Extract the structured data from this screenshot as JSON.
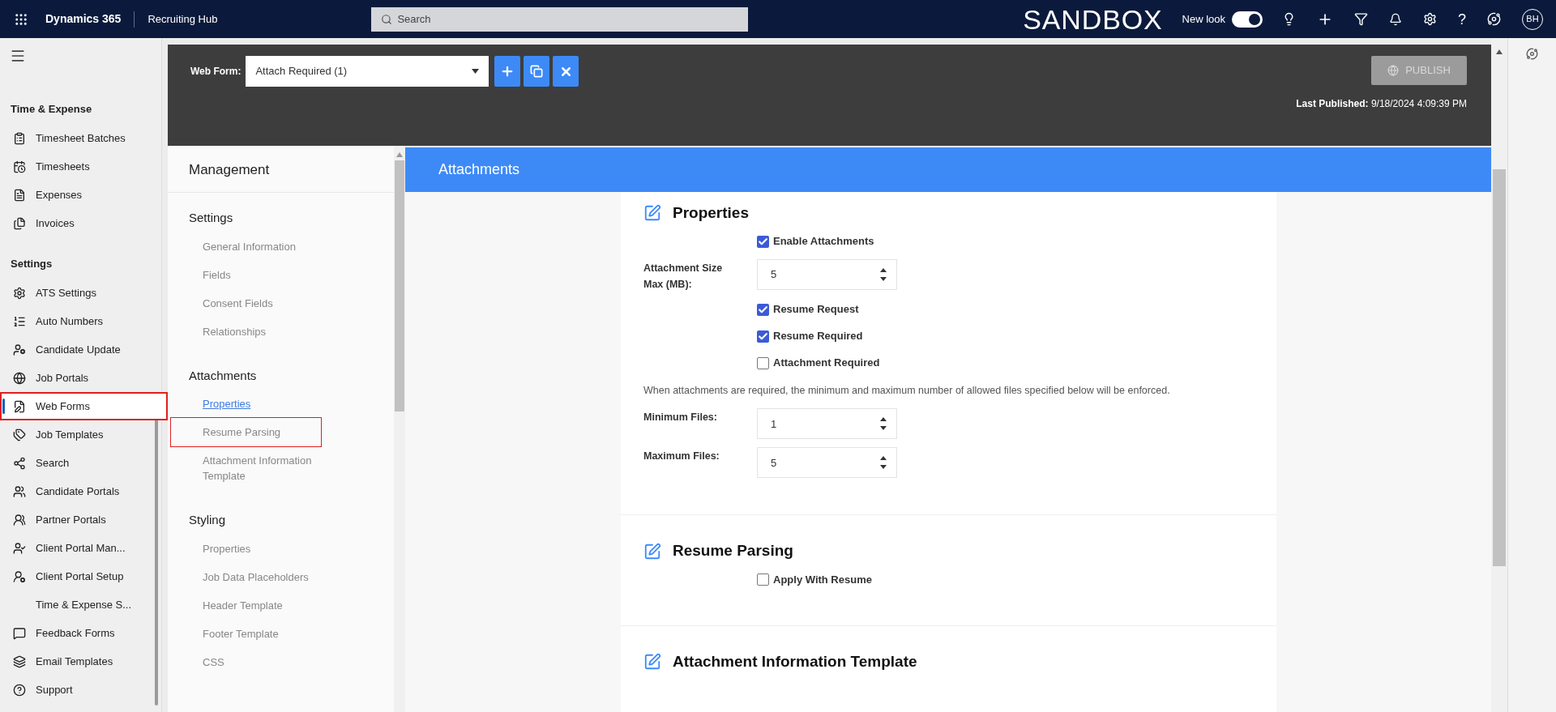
{
  "top_bar": {
    "app_name": "Dynamics 365",
    "area": "Recruiting Hub",
    "search": {
      "placeholder": "Search"
    },
    "environment": "SANDBOX",
    "new_look": {
      "label": "New look",
      "on": true
    },
    "help": "?",
    "avatar": "BH"
  },
  "sidebar": {
    "sections": [
      {
        "title": "Time & Expense",
        "items": [
          {
            "label": "Timesheet Batches",
            "selected": false,
            "highlighted": false
          },
          {
            "label": "Timesheets",
            "selected": false,
            "highlighted": false
          },
          {
            "label": "Expenses",
            "selected": false,
            "highlighted": false
          },
          {
            "label": "Invoices",
            "selected": false,
            "highlighted": false
          }
        ]
      },
      {
        "title": "Settings",
        "items": [
          {
            "label": "ATS Settings",
            "selected": false,
            "highlighted": false
          },
          {
            "label": "Auto Numbers",
            "selected": false,
            "highlighted": false
          },
          {
            "label": "Candidate Update",
            "selected": false,
            "highlighted": false
          },
          {
            "label": "Job Portals",
            "selected": false,
            "highlighted": false
          },
          {
            "label": "Web Forms",
            "selected": true,
            "highlighted": true
          },
          {
            "label": "Job Templates",
            "selected": false,
            "highlighted": false
          },
          {
            "label": "Search",
            "selected": false,
            "highlighted": false
          },
          {
            "label": "Candidate Portals",
            "selected": false,
            "highlighted": false
          },
          {
            "label": "Partner Portals",
            "selected": false,
            "highlighted": false
          },
          {
            "label": "Client Portal Man...",
            "selected": false,
            "highlighted": false
          },
          {
            "label": "Client Portal Setup",
            "selected": false,
            "highlighted": false
          },
          {
            "label": "Time & Expense S...",
            "selected": false,
            "highlighted": false
          },
          {
            "label": "Feedback Forms",
            "selected": false,
            "highlighted": false
          },
          {
            "label": "Email Templates",
            "selected": false,
            "highlighted": false
          },
          {
            "label": "Support",
            "selected": false,
            "highlighted": false
          }
        ]
      }
    ]
  },
  "web_form": {
    "label": "Web Form:",
    "value": "Attach Required (1)",
    "publish": "PUBLISH",
    "publish_disabled": true,
    "last_published_label": "Last Published:",
    "last_published": "9/18/2024 4:09:39 PM"
  },
  "management": {
    "title": "Management",
    "groups": [
      {
        "title": "Settings",
        "items": [
          {
            "label": "General Information",
            "selected": false,
            "highlighted": false
          },
          {
            "label": "Fields",
            "selected": false,
            "highlighted": false
          },
          {
            "label": "Consent Fields",
            "selected": false,
            "highlighted": false
          },
          {
            "label": "Relationships",
            "selected": false,
            "highlighted": false
          }
        ]
      },
      {
        "title": "Attachments",
        "items": [
          {
            "label": "Properties",
            "selected": true,
            "highlighted": false
          },
          {
            "label": "Resume Parsing",
            "selected": false,
            "highlighted": true
          },
          {
            "label": "Attachment Information Template",
            "selected": false,
            "highlighted": false
          }
        ]
      },
      {
        "title": "Styling",
        "items": [
          {
            "label": "Properties",
            "selected": false,
            "highlighted": false
          },
          {
            "label": "Job Data Placeholders",
            "selected": false,
            "highlighted": false
          },
          {
            "label": "Header Template",
            "selected": false,
            "highlighted": false
          },
          {
            "label": "Footer Template",
            "selected": false,
            "highlighted": false
          },
          {
            "label": "CSS",
            "selected": false,
            "highlighted": false
          }
        ]
      }
    ]
  },
  "page": {
    "title": "Attachments",
    "sections": [
      {
        "title": "Properties",
        "rows": [
          {
            "kind": "checkbox",
            "label": "Enable Attachments",
            "checked": true
          },
          {
            "kind": "number",
            "label": "Attachment Size Max (MB):",
            "value": "5"
          },
          {
            "kind": "checkbox",
            "label": "Resume Request",
            "checked": true
          },
          {
            "kind": "checkbox",
            "label": "Resume Required",
            "checked": true
          },
          {
            "kind": "checkbox",
            "label": "Attachment Required",
            "checked": false
          },
          {
            "kind": "note",
            "text": "When attachments are required, the minimum and maximum number of allowed files specified below will be enforced."
          },
          {
            "kind": "number",
            "label": "Minimum Files:",
            "value": "1"
          },
          {
            "kind": "number",
            "label": "Maximum Files:",
            "value": "5"
          }
        ]
      },
      {
        "title": "Resume Parsing",
        "rows": [
          {
            "kind": "checkbox",
            "label": "Apply With Resume",
            "checked": false
          }
        ]
      },
      {
        "title": "Attachment Information Template"
      }
    ]
  }
}
